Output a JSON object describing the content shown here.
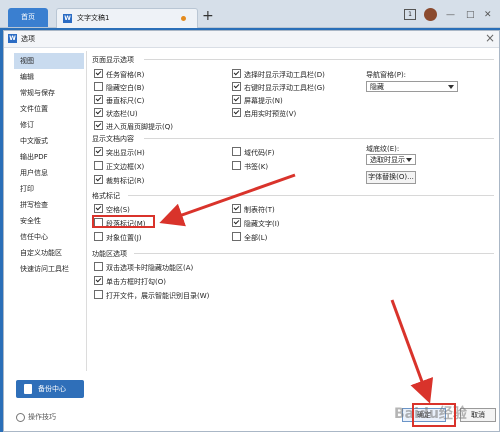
{
  "app": {
    "home_tab": "首页",
    "doc_tab": "文字文稿1",
    "new_tab": "+",
    "page_icon": "1",
    "colors": {
      "accent": "#2f6fb9",
      "highlight": "#d9332b"
    }
  },
  "dialog": {
    "title": "选项",
    "close": "×"
  },
  "sidebar": {
    "items": [
      {
        "label": "视图"
      },
      {
        "label": "编辑"
      },
      {
        "label": "常规与保存"
      },
      {
        "label": "文件位置"
      },
      {
        "label": "修订"
      },
      {
        "label": "中文版式"
      },
      {
        "label": "输出PDF"
      },
      {
        "label": "用户信息"
      },
      {
        "label": "打印"
      },
      {
        "label": "拼写检查"
      },
      {
        "label": "安全性"
      },
      {
        "label": "信任中心"
      },
      {
        "label": "自定义功能区"
      },
      {
        "label": "快速访问工具栏"
      }
    ],
    "backup": "备份中心",
    "tips": "操作技巧"
  },
  "page_display": {
    "title": "页面显示选项",
    "left": [
      {
        "label": "任务窗格(R)",
        "checked": true
      },
      {
        "label": "隐藏空白(B)",
        "checked": false
      },
      {
        "label": "垂直标尺(C)",
        "checked": true
      },
      {
        "label": "状态栏(U)",
        "checked": true
      },
      {
        "label": "进入页眉页脚提示(Q)",
        "checked": true
      }
    ],
    "right": [
      {
        "label": "选择时显示浮动工具栏(D)",
        "checked": true
      },
      {
        "label": "右键时显示浮动工具栏(G)",
        "checked": true
      },
      {
        "label": "屏幕提示(N)",
        "checked": true
      },
      {
        "label": "启用实时预览(V)",
        "checked": true
      }
    ],
    "nav_label": "导航窗格(P):",
    "nav_value": "隐藏"
  },
  "doc_content": {
    "title": "显示文档内容",
    "left": [
      {
        "label": "突出显示(H)",
        "checked": true
      },
      {
        "label": "正文边框(X)",
        "checked": false
      },
      {
        "label": "裁剪标记(R)",
        "checked": true
      }
    ],
    "right": [
      {
        "label": "域代码(F)",
        "checked": false
      },
      {
        "label": "书签(K)",
        "checked": false
      }
    ],
    "field_label": "域底纹(E):",
    "field_value": "选取时显示",
    "font_button": "字体替换(O)..."
  },
  "format_marks": {
    "title": "格式标记",
    "left": [
      {
        "label": "空格(S)",
        "checked": true
      },
      {
        "label": "段落标记(M)",
        "checked": false
      },
      {
        "label": "对象位置(J)",
        "checked": false
      }
    ],
    "right": [
      {
        "label": "制表符(T)",
        "checked": true
      },
      {
        "label": "隐藏文字(I)",
        "checked": true
      },
      {
        "label": "全部(L)",
        "checked": false
      }
    ]
  },
  "ribbon": {
    "title": "功能区选项",
    "items": [
      {
        "label": "双击选项卡时隐藏功能区(A)",
        "checked": false
      },
      {
        "label": "单击方框时打勾(O)",
        "checked": true
      },
      {
        "label": "打开文件，展示智能识别目录(W)",
        "checked": false
      }
    ]
  },
  "footer": {
    "ok": "确定",
    "cancel": "取消"
  },
  "watermark": "Baidu经验"
}
